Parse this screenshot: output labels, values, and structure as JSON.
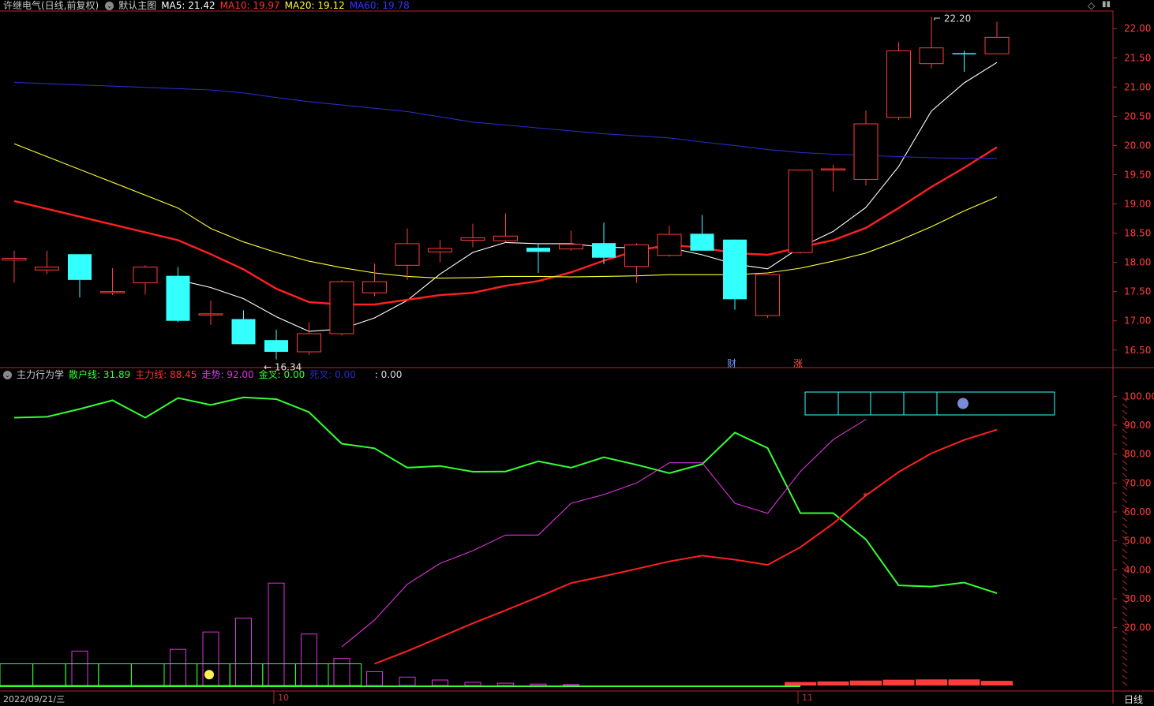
{
  "header": {
    "stock": "许继电气(日线,前复权)",
    "template": "默认主图",
    "ma5_label": "MA5: 21.42",
    "ma10_label": "MA10: 19.97",
    "ma20_label": "MA20: 19.12",
    "ma60_label": "MA60: 19.78"
  },
  "subheader": {
    "name": "主力行为学",
    "retail_label": "散户线: 31.89",
    "main_label": "主力线: 88.45",
    "trend_label": "走势: 92.00",
    "gold_label": "金叉: 0.00",
    "death_label": "死叉: 0.00",
    "blank_label": ": 0.00"
  },
  "axis": {
    "date_start": "2022/09/21/三",
    "month_10": "10",
    "month_11": "11",
    "period": "日线"
  },
  "markers": {
    "cai": "财",
    "zhang": "涨"
  },
  "chart_data": [
    {
      "type": "candlestick",
      "title": "许继电气(日线,前复权)",
      "ylim": [
        16.2,
        22.3
      ],
      "yticks": [
        16.5,
        17.0,
        17.5,
        18.0,
        18.5,
        19.0,
        19.5,
        20.0,
        20.5,
        21.0,
        21.5,
        22.0
      ],
      "annotations": [
        {
          "text": "22.20",
          "bar": 28
        },
        {
          "text": "16.34",
          "bar": 8
        }
      ],
      "candles": [
        {
          "o": 18.04,
          "h": 18.2,
          "l": 17.65,
          "c": 18.07
        },
        {
          "o": 17.87,
          "h": 18.2,
          "l": 17.8,
          "c": 17.92
        },
        {
          "o": 18.14,
          "h": 18.14,
          "l": 17.4,
          "c": 17.7
        },
        {
          "o": 17.48,
          "h": 17.9,
          "l": 17.44,
          "c": 17.5
        },
        {
          "o": 17.65,
          "h": 17.95,
          "l": 17.45,
          "c": 17.92
        },
        {
          "o": 17.77,
          "h": 17.92,
          "l": 16.98,
          "c": 17.0
        },
        {
          "o": 17.12,
          "h": 17.35,
          "l": 16.93,
          "c": 17.12
        },
        {
          "o": 17.03,
          "h": 17.18,
          "l": 16.6,
          "c": 16.6
        },
        {
          "o": 16.67,
          "h": 16.85,
          "l": 16.34,
          "c": 16.47
        },
        {
          "o": 16.47,
          "h": 16.98,
          "l": 16.42,
          "c": 16.78
        },
        {
          "o": 16.78,
          "h": 17.7,
          "l": 16.75,
          "c": 17.67
        },
        {
          "o": 17.48,
          "h": 17.98,
          "l": 17.42,
          "c": 17.67
        },
        {
          "o": 17.95,
          "h": 18.58,
          "l": 17.7,
          "c": 18.32
        },
        {
          "o": 18.18,
          "h": 18.38,
          "l": 18.0,
          "c": 18.24
        },
        {
          "o": 18.38,
          "h": 18.66,
          "l": 18.26,
          "c": 18.42
        },
        {
          "o": 18.37,
          "h": 18.84,
          "l": 18.34,
          "c": 18.45
        },
        {
          "o": 18.25,
          "h": 18.32,
          "l": 17.82,
          "c": 18.18
        },
        {
          "o": 18.23,
          "h": 18.54,
          "l": 18.2,
          "c": 18.31
        },
        {
          "o": 18.33,
          "h": 18.68,
          "l": 17.97,
          "c": 18.08
        },
        {
          "o": 17.93,
          "h": 18.33,
          "l": 17.65,
          "c": 18.3
        },
        {
          "o": 18.12,
          "h": 18.62,
          "l": 18.1,
          "c": 18.48
        },
        {
          "o": 18.49,
          "h": 18.81,
          "l": 18.2,
          "c": 18.2
        },
        {
          "o": 18.39,
          "h": 18.39,
          "l": 17.19,
          "c": 17.37
        },
        {
          "o": 17.09,
          "h": 17.8,
          "l": 17.05,
          "c": 17.79
        },
        {
          "o": 18.17,
          "h": 19.58,
          "l": 18.15,
          "c": 19.58
        },
        {
          "o": 19.58,
          "h": 19.67,
          "l": 19.22,
          "c": 19.6
        },
        {
          "o": 19.42,
          "h": 20.6,
          "l": 19.32,
          "c": 20.37
        },
        {
          "o": 20.48,
          "h": 21.77,
          "l": 20.44,
          "c": 21.62
        },
        {
          "o": 21.4,
          "h": 22.2,
          "l": 21.32,
          "c": 21.67
        },
        {
          "o": 21.58,
          "h": 21.62,
          "l": 21.26,
          "c": 21.56
        },
        {
          "o": 21.57,
          "h": 22.12,
          "l": 21.57,
          "c": 21.85
        }
      ],
      "series": [
        {
          "name": "MA5",
          "color": "#ffffff",
          "values": [
            null,
            null,
            null,
            null,
            null,
            17.7,
            17.57,
            17.38,
            17.07,
            16.82,
            16.86,
            17.05,
            17.35,
            17.8,
            18.17,
            18.34,
            18.32,
            18.32,
            18.26,
            18.25,
            18.25,
            18.13,
            17.97,
            17.89,
            18.26,
            18.53,
            18.94,
            19.64,
            20.59,
            21.07,
            21.42
          ]
        },
        {
          "name": "MA10",
          "color": "#ff2020",
          "values": [
            19.05,
            null,
            null,
            null,
            null,
            18.38,
            18.14,
            17.88,
            17.55,
            17.32,
            17.28,
            17.28,
            17.36,
            17.44,
            17.48,
            17.6,
            17.68,
            17.83,
            18.03,
            18.2,
            18.3,
            18.25,
            18.16,
            18.13,
            18.26,
            18.38,
            18.59,
            18.93,
            19.29,
            19.62,
            19.97
          ]
        },
        {
          "name": "MA20",
          "color": "#ffff33",
          "values": [
            20.03,
            null,
            null,
            null,
            null,
            18.93,
            18.58,
            18.35,
            18.17,
            18.02,
            17.91,
            17.82,
            17.76,
            17.73,
            17.74,
            17.76,
            17.76,
            17.75,
            17.76,
            17.77,
            17.79,
            17.79,
            17.79,
            17.82,
            17.9,
            18.02,
            18.16,
            18.37,
            18.61,
            18.88,
            19.12
          ]
        },
        {
          "name": "MA60",
          "color": "#2a2ac8",
          "values": [
            21.08,
            null,
            null,
            null,
            null,
            null,
            20.95,
            20.9,
            20.82,
            20.75,
            null,
            null,
            20.58,
            null,
            20.4,
            20.35,
            null,
            null,
            20.2,
            null,
            20.13,
            20.06,
            20.0,
            19.93,
            19.88,
            19.85,
            19.83,
            19.81,
            19.79,
            19.78,
            19.78
          ]
        }
      ]
    },
    {
      "type": "line",
      "title": "主力行为学",
      "ylim": [
        0,
        105
      ],
      "yticks": [
        20,
        30,
        40,
        50,
        60,
        70,
        80,
        90,
        100
      ],
      "series": [
        {
          "name": "散户线",
          "color": "#33ff33",
          "values": [
            92.6,
            92.9,
            95.6,
            98.6,
            92.6,
            99.4,
            97.0,
            99.6,
            99.0,
            94.5,
            83.6,
            82.0,
            75.3,
            75.9,
            73.9,
            74.0,
            77.5,
            75.3,
            78.9,
            76.3,
            73.4,
            76.5,
            87.4,
            82.1,
            59.6,
            59.6,
            50.5,
            34.6,
            34.2,
            35.6,
            31.89
          ]
        },
        {
          "name": "主力线",
          "color": "#ff2020",
          "values": [
            null,
            null,
            null,
            null,
            null,
            null,
            null,
            null,
            null,
            null,
            null,
            7.5,
            11.9,
            16.7,
            21.5,
            26.0,
            30.6,
            35.4,
            37.8,
            40.3,
            42.9,
            44.9,
            43.5,
            41.7,
            47.8,
            56.0,
            65.7,
            73.8,
            80.3,
            84.9,
            88.45
          ]
        },
        {
          "name": "走势",
          "color": "#dd33dd",
          "values": [
            null,
            null,
            null,
            null,
            null,
            null,
            null,
            null,
            null,
            null,
            13.4,
            22.6,
            35.0,
            42.2,
            46.6,
            52.0,
            52.0,
            63.0,
            66.0,
            70.0,
            77.0,
            77.0,
            63.0,
            59.5,
            74.0,
            85.0,
            92.0
          ]
        }
      ],
      "volume_bars": [
        0,
        0,
        11.9,
        0,
        0,
        12.5,
        18.5,
        23.3,
        35.4,
        17.8,
        9.4,
        4.8,
        2.9,
        1.9,
        1.1,
        0.8,
        0.5,
        0.3,
        0,
        0,
        0,
        0,
        0,
        0,
        1.2,
        1.4,
        1.7,
        2.0,
        2.1,
        2.1,
        1.6
      ]
    }
  ]
}
